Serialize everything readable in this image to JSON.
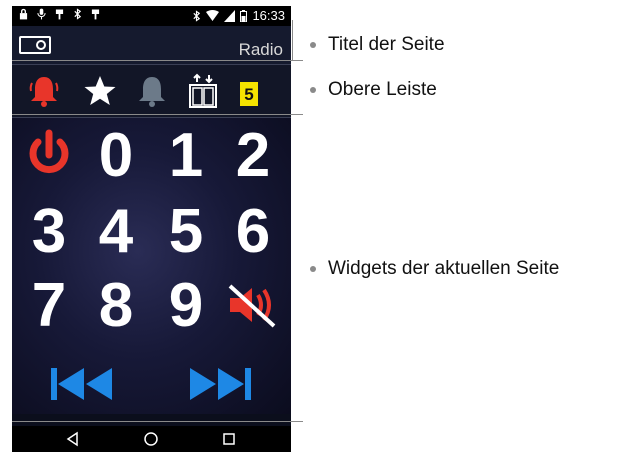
{
  "status_bar": {
    "time": "16:33"
  },
  "title_bar": {
    "title": "Radio"
  },
  "top_bar": {
    "badge_value": "5"
  },
  "keypad": {
    "keys": [
      "0",
      "1",
      "2",
      "3",
      "4",
      "5",
      "6",
      "7",
      "8",
      "9"
    ]
  },
  "annotations": {
    "title": "Titel der Seite",
    "top_bar": "Obere Leiste",
    "widgets": "Widgets der aktuellen Seite"
  },
  "colors": {
    "accent_red": "#e8352a",
    "accent_blue": "#1e88e5",
    "badge_yellow": "#f5e300",
    "grey_bell": "#6c7a89"
  },
  "icons": {
    "status_left": [
      "lock-icon",
      "microphone-icon",
      "usb-icon",
      "bluetooth-icon",
      "usb-icon"
    ],
    "status_right": [
      "bluetooth-icon",
      "wifi-icon",
      "signal-icon",
      "battery-icon"
    ],
    "top_bar": [
      "red-bell-icon",
      "star-icon",
      "grey-bell-icon",
      "elevator-icon",
      "badge"
    ],
    "nav": [
      "back-icon",
      "home-icon",
      "recents-icon"
    ]
  }
}
